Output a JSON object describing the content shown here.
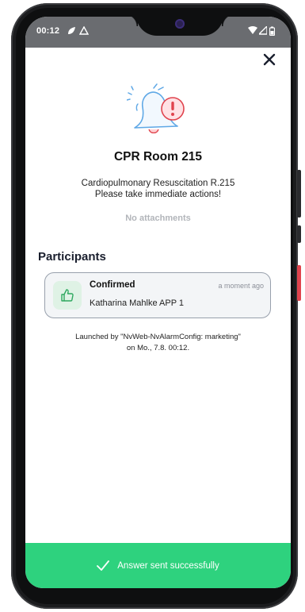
{
  "status_bar": {
    "time": "00:12"
  },
  "alarm": {
    "title": "CPR Room 215",
    "description_line1": "Cardiopulmonary Resuscitation R.215",
    "description_line2": "Please take immediate actions!",
    "attachments_text": "No attachments"
  },
  "participants": {
    "heading": "Participants",
    "items": [
      {
        "status": "Confirmed",
        "time": "a moment ago",
        "name": "Katharina Mahlke APP 1"
      }
    ]
  },
  "launch_info": {
    "line1": "Launched by \"NvWeb-NvAlarmConfig: marketing\"",
    "line2": "on Mo., 7.8. 00:12."
  },
  "toast": {
    "text": "Answer sent successfully"
  },
  "colors": {
    "success": "#2ed27e",
    "alert_red": "#e0434d",
    "bell_blue": "#5fa8e6"
  }
}
